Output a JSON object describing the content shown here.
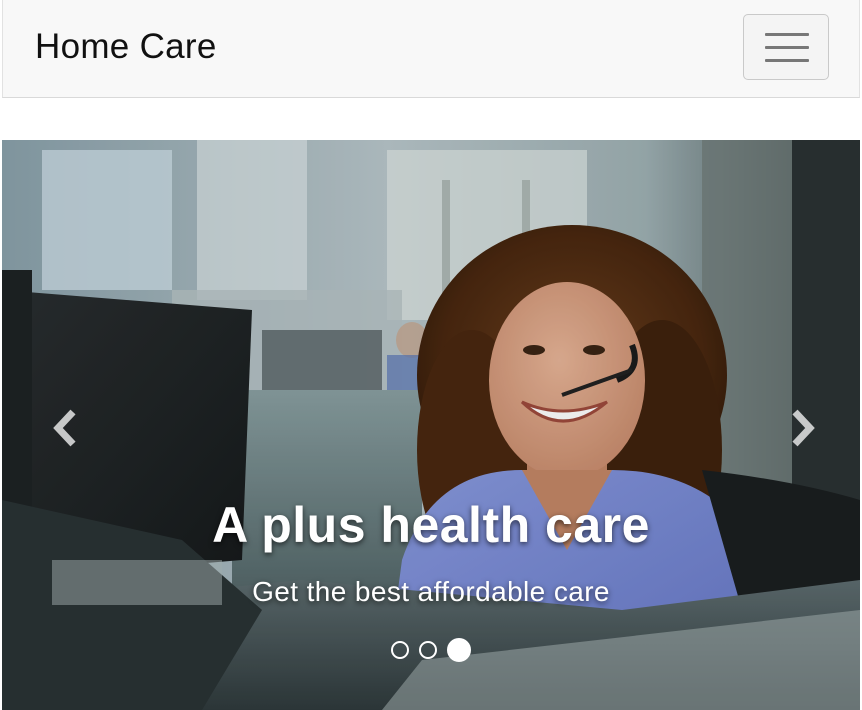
{
  "navbar": {
    "brand": "Home Care",
    "toggle_icon": "hamburger-menu-icon"
  },
  "carousel": {
    "caption_title": "A plus health care",
    "caption_text": "Get the best affordable care",
    "prev_icon": "chevron-left-icon",
    "next_icon": "chevron-right-icon",
    "slide_count": 3,
    "active_slide": 3
  },
  "colors": {
    "navbar_bg": "#f8f8f8",
    "caption_text": "#ffffff",
    "scrubs": "#7b8fd6"
  }
}
